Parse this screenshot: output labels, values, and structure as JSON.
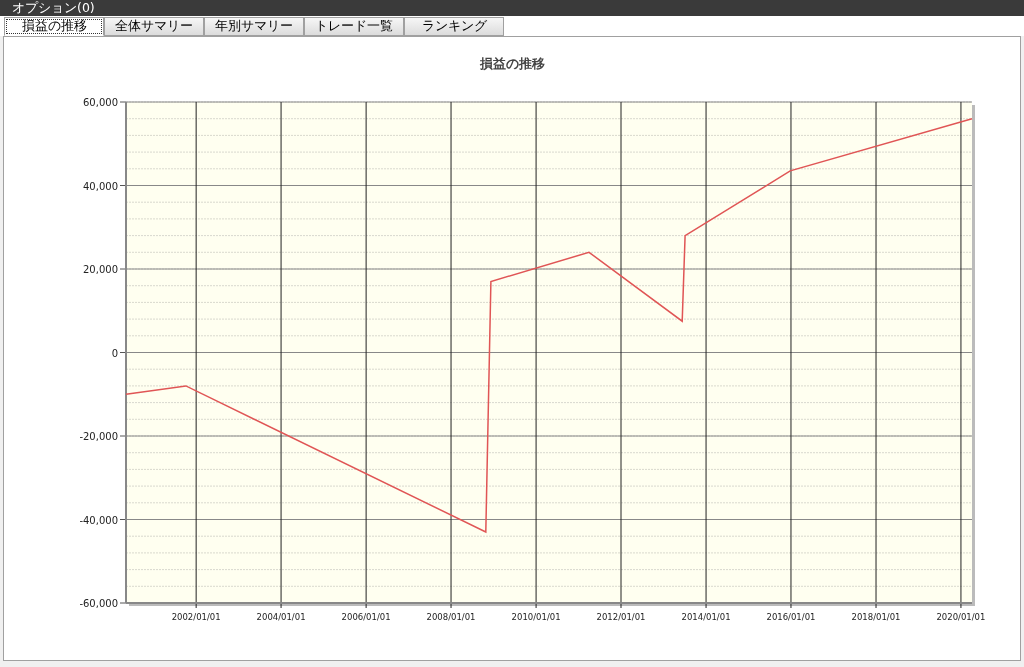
{
  "window": {
    "title": "オプション(0)"
  },
  "tabs": [
    {
      "label": "損益の推移",
      "selected": true
    },
    {
      "label": "全体サマリー",
      "selected": false
    },
    {
      "label": "年別サマリー",
      "selected": false
    },
    {
      "label": "トレード一覧",
      "selected": false
    },
    {
      "label": "ランキング",
      "selected": false
    }
  ],
  "chart": {
    "chart_data": {
      "type": "line",
      "title": "損益の推移",
      "x": [
        "2000-05-08",
        "2001-10-05",
        "2008-10-26",
        "2008-12-09",
        "2011-04-01",
        "2013-06-10",
        "2013-07-05",
        "2015-12-25",
        "2020-04-05"
      ],
      "series": [
        {
          "color": "#e05555",
          "values": [
            -10000,
            -8000,
            -43000,
            17000,
            24000,
            7500,
            28000,
            43500,
            56000
          ]
        }
      ],
      "grid": true,
      "xlim": [
        "2000-05-08",
        "2020-04-05"
      ],
      "ylim": [
        -60000,
        60000
      ],
      "xticks": [
        {
          "value": "2002-01-01",
          "label": "2002/01/01"
        },
        {
          "value": "2004-01-01",
          "label": "2004/01/01"
        },
        {
          "value": "2006-01-01",
          "label": "2006/01/01"
        },
        {
          "value": "2008-01-01",
          "label": "2008/01/01"
        },
        {
          "value": "2010-01-01",
          "label": "2010/01/01"
        },
        {
          "value": "2012-01-01",
          "label": "2012/01/01"
        },
        {
          "value": "2014-01-01",
          "label": "2014/01/01"
        },
        {
          "value": "2016-01-01",
          "label": "2016/01/01"
        },
        {
          "value": "2018-01-01",
          "label": "2018/01/01"
        },
        {
          "value": "2020-01-01",
          "label": "2020/01/01"
        }
      ],
      "yticks": [
        {
          "value": 60000,
          "label": "60,000"
        },
        {
          "value": 40000,
          "label": "40,000"
        },
        {
          "value": 20000,
          "label": "20,000"
        },
        {
          "value": 0,
          "label": "0"
        },
        {
          "value": -20000,
          "label": "-20,000"
        },
        {
          "value": -40000,
          "label": "-40,000"
        },
        {
          "value": -60000,
          "label": "-60,000"
        }
      ]
    }
  }
}
